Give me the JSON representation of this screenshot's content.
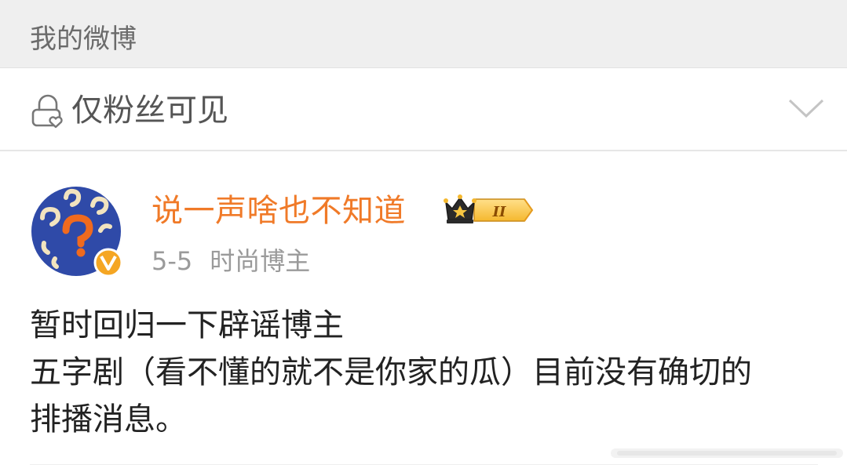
{
  "header": {
    "title": "我的微博"
  },
  "visibility": {
    "label": "仅粉丝可见",
    "icon": "lock-heart-icon",
    "expand_icon": "chevron-down-icon"
  },
  "post": {
    "author": "说一声啥也不知道",
    "badge_text": "II",
    "date": "5-5",
    "source": "时尚博主",
    "lines": [
      "暂时回归一下辟谣博主",
      "五字剧（看不懂的就不是你家的瓜）目前没有确切的",
      "排播消息。"
    ]
  },
  "colors": {
    "author": "#f07a28",
    "header_bg": "#efefef",
    "text": "#222222",
    "muted": "#9a9a9a"
  }
}
